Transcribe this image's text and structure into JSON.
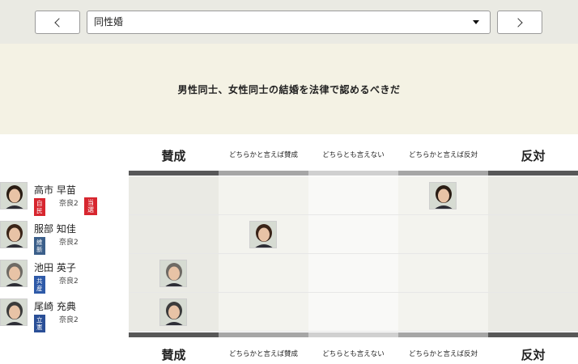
{
  "nav": {
    "selected_topic": "同性婚"
  },
  "question": "男性同士、女性同士の結婚を法律で認めるべきだ",
  "columns": [
    {
      "line1": "賛成",
      "line2": "",
      "size": "big"
    },
    {
      "line1": "どちらかと",
      "line2": "言えば賛成",
      "size": "small"
    },
    {
      "line1": "どちらとも",
      "line2": "言えない",
      "size": "small"
    },
    {
      "line1": "どちらかと",
      "line2": "言えば反対",
      "size": "small"
    },
    {
      "line1": "反対",
      "line2": "",
      "size": "big"
    }
  ],
  "candidates": [
    {
      "name": "高市 早苗",
      "party": "自民",
      "party_color": "#d7262f",
      "district": "奈良2",
      "badge": "当選",
      "answer_index": 3
    },
    {
      "name": "服部 知佳",
      "party": "維新",
      "party_color": "#3b5f8a",
      "district": "奈良2",
      "badge": "",
      "answer_index": 1
    },
    {
      "name": "池田 英子",
      "party": "共産",
      "party_color": "#2e5aa8",
      "district": "奈良2",
      "badge": "",
      "answer_index": 0
    },
    {
      "name": "尾崎 充典",
      "party": "立憲",
      "party_color": "#2a4f97",
      "district": "奈良2",
      "badge": "",
      "answer_index": 0
    }
  ]
}
